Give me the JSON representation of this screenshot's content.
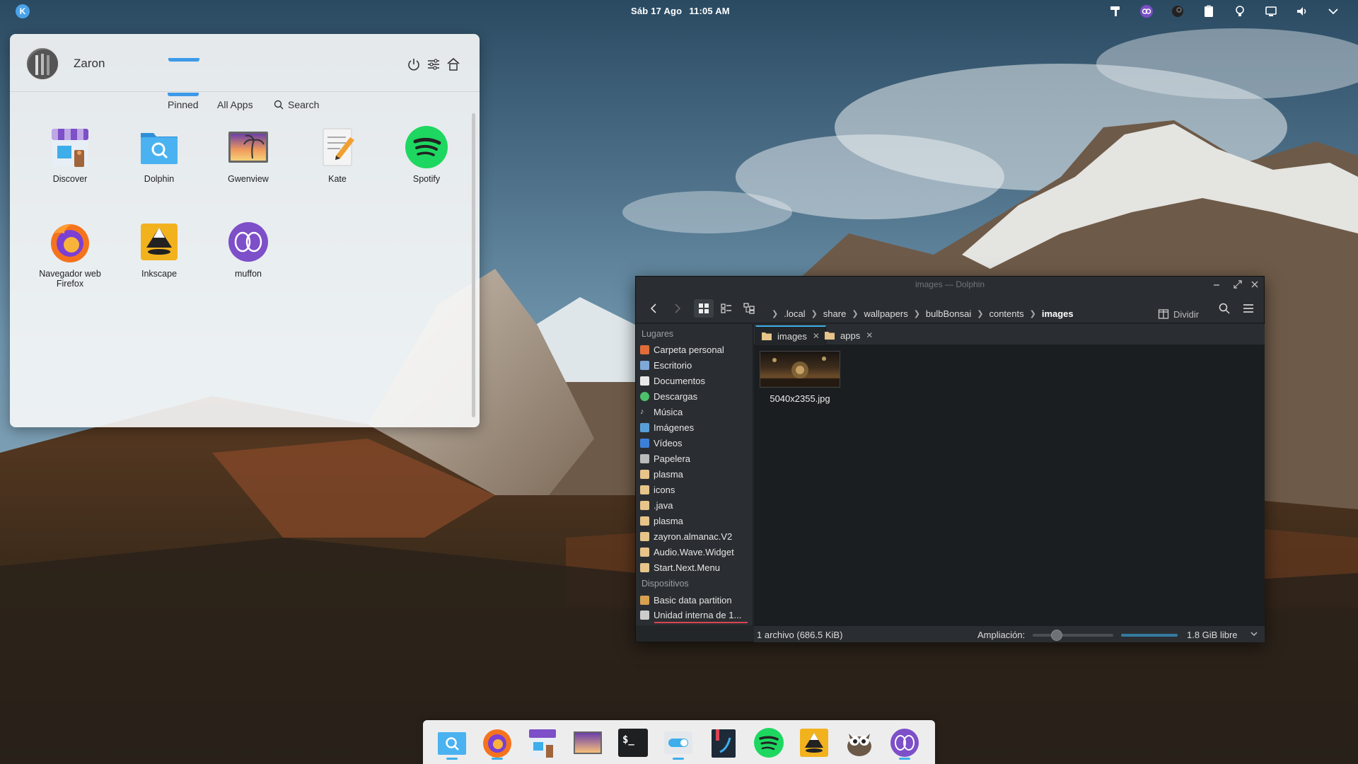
{
  "top_panel": {
    "date": "Sáb 17 Ago",
    "time": "11:05 AM",
    "launcher_glyph": "K"
  },
  "start_menu": {
    "user": "Zaron",
    "tabs": {
      "pinned": "Pinned",
      "all_apps": "All Apps",
      "search": "Search"
    },
    "apps": [
      {
        "label": "Discover",
        "icon": "discover-icon"
      },
      {
        "label": "Dolphin",
        "icon": "dolphin-icon"
      },
      {
        "label": "Gwenview",
        "icon": "gwenview-icon"
      },
      {
        "label": "Kate",
        "icon": "kate-icon"
      },
      {
        "label": "Spotify",
        "icon": "spotify-icon"
      },
      {
        "label": "Navegador web",
        "label2": "Firefox",
        "icon": "firefox-icon"
      },
      {
        "label": "Inkscape",
        "icon": "inkscape-icon"
      },
      {
        "label": "muffon",
        "icon": "muffon-icon"
      }
    ]
  },
  "dolphin": {
    "title": "images — Dolphin",
    "breadcrumb": [
      ".local",
      "share",
      "wallpapers",
      "bulbBonsai",
      "contents",
      "images"
    ],
    "split_label": "Dividir",
    "places_heading": "Lugares",
    "places": [
      "Carpeta personal",
      "Escritorio",
      "Documentos",
      "Descargas",
      "Música",
      "Imágenes",
      "Vídeos",
      "Papelera",
      "plasma",
      "icons",
      ".java",
      "plasma",
      "zayron.almanac.V2",
      "Audio.Wave.Widget",
      "Start.Next.Menu"
    ],
    "devices_heading": "Dispositivos",
    "devices": [
      "Basic data partition",
      "Unidad interna de 1..."
    ],
    "view_tabs": [
      "images",
      "apps"
    ],
    "file": {
      "name": "5040x2355.jpg"
    },
    "status": {
      "text": "1 archivo (686.5 KiB)",
      "zoom_label": "Ampliación:",
      "free_space": "1.8 GiB libre"
    }
  },
  "dock": {
    "items": [
      "dolphin-icon",
      "firefox-icon",
      "discover-icon",
      "gwenview-icon",
      "terminal-icon",
      "settings-icon",
      "kate-icon",
      "spotify-icon",
      "inkscape-icon",
      "gimp-icon",
      "muffon-icon"
    ],
    "terminal_glyph": "$_"
  },
  "colors": {
    "accent": "#3daee9",
    "dolphin_bg": "#232629",
    "menu_bg": "#f8f9fa"
  }
}
